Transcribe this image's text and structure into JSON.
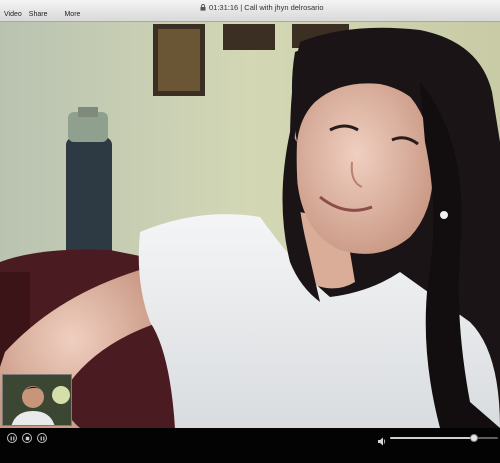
{
  "window": {
    "title": "01:31:16 | Call with jhyn delrosario"
  },
  "menu": {
    "video_label": "Video",
    "share_label": "Share",
    "more_label": "More"
  },
  "video": {
    "remote_feed": "remote-video-feed",
    "self_view": "self-view-thumbnail"
  },
  "controls": {
    "buttons": [
      "pause-icon",
      "stop-icon",
      "pause-icon"
    ],
    "volume_level": 0.78
  }
}
